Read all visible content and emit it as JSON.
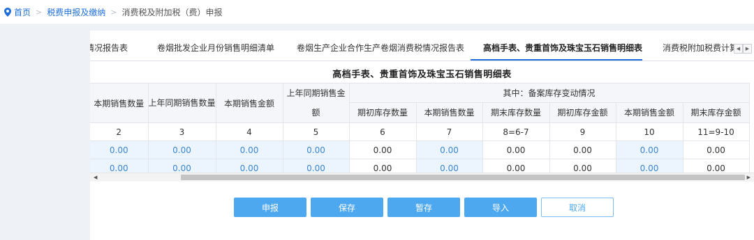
{
  "breadcrumb": {
    "home": "首页",
    "section": "税费申报及缴纳",
    "current": "消费税及附加税（费）申报"
  },
  "tabs": [
    {
      "label": "情况报告表",
      "active": false
    },
    {
      "label": "卷烟批发企业月份销售明细清单",
      "active": false
    },
    {
      "label": "卷烟生产企业合作生产卷烟消费税情况报告表",
      "active": false
    },
    {
      "label": "高档手表、贵重首饰及珠宝玉石销售明细表",
      "active": true
    },
    {
      "label": "消费税附加税费计算",
      "active": false
    }
  ],
  "table": {
    "title": "高档手表、贵重首饰及珠宝玉石销售明细表",
    "headers": {
      "col_current_qty": "本期销售数量",
      "col_prev_qty": "上年同期销售数量",
      "col_current_amt": "本期销售金额",
      "col_prev_amt": "上年同期销售金额",
      "group": "其中：备案库存变动情况",
      "sub": [
        "期初库存数量",
        "本期销售数量",
        "期末库存数量",
        "期初库存金额",
        "本期销售金额",
        "期末库存金额"
      ]
    },
    "index_row": [
      "2",
      "3",
      "4",
      "5",
      "6",
      "7",
      "8=6-7",
      "9",
      "10",
      "11=9-10"
    ],
    "rows": [
      [
        "0.00",
        "0.00",
        "0.00",
        "0.00",
        "0.00",
        "0.00",
        "0.00",
        "0.00",
        "0.00",
        "0.00"
      ],
      [
        "0.00",
        "0.00",
        "0.00",
        "0.00",
        "0.00",
        "0.00",
        "0.00",
        "0.00",
        "0.00",
        "0.00"
      ]
    ]
  },
  "buttons": {
    "declare": "申报",
    "save": "保存",
    "temp_save": "暂存",
    "import": "导入",
    "cancel": "取消"
  },
  "colors": {
    "accent": "#1e6fd9",
    "button": "#4ea8f0",
    "input_cell": "#ecf5fe",
    "input_text": "#3a86d4"
  }
}
